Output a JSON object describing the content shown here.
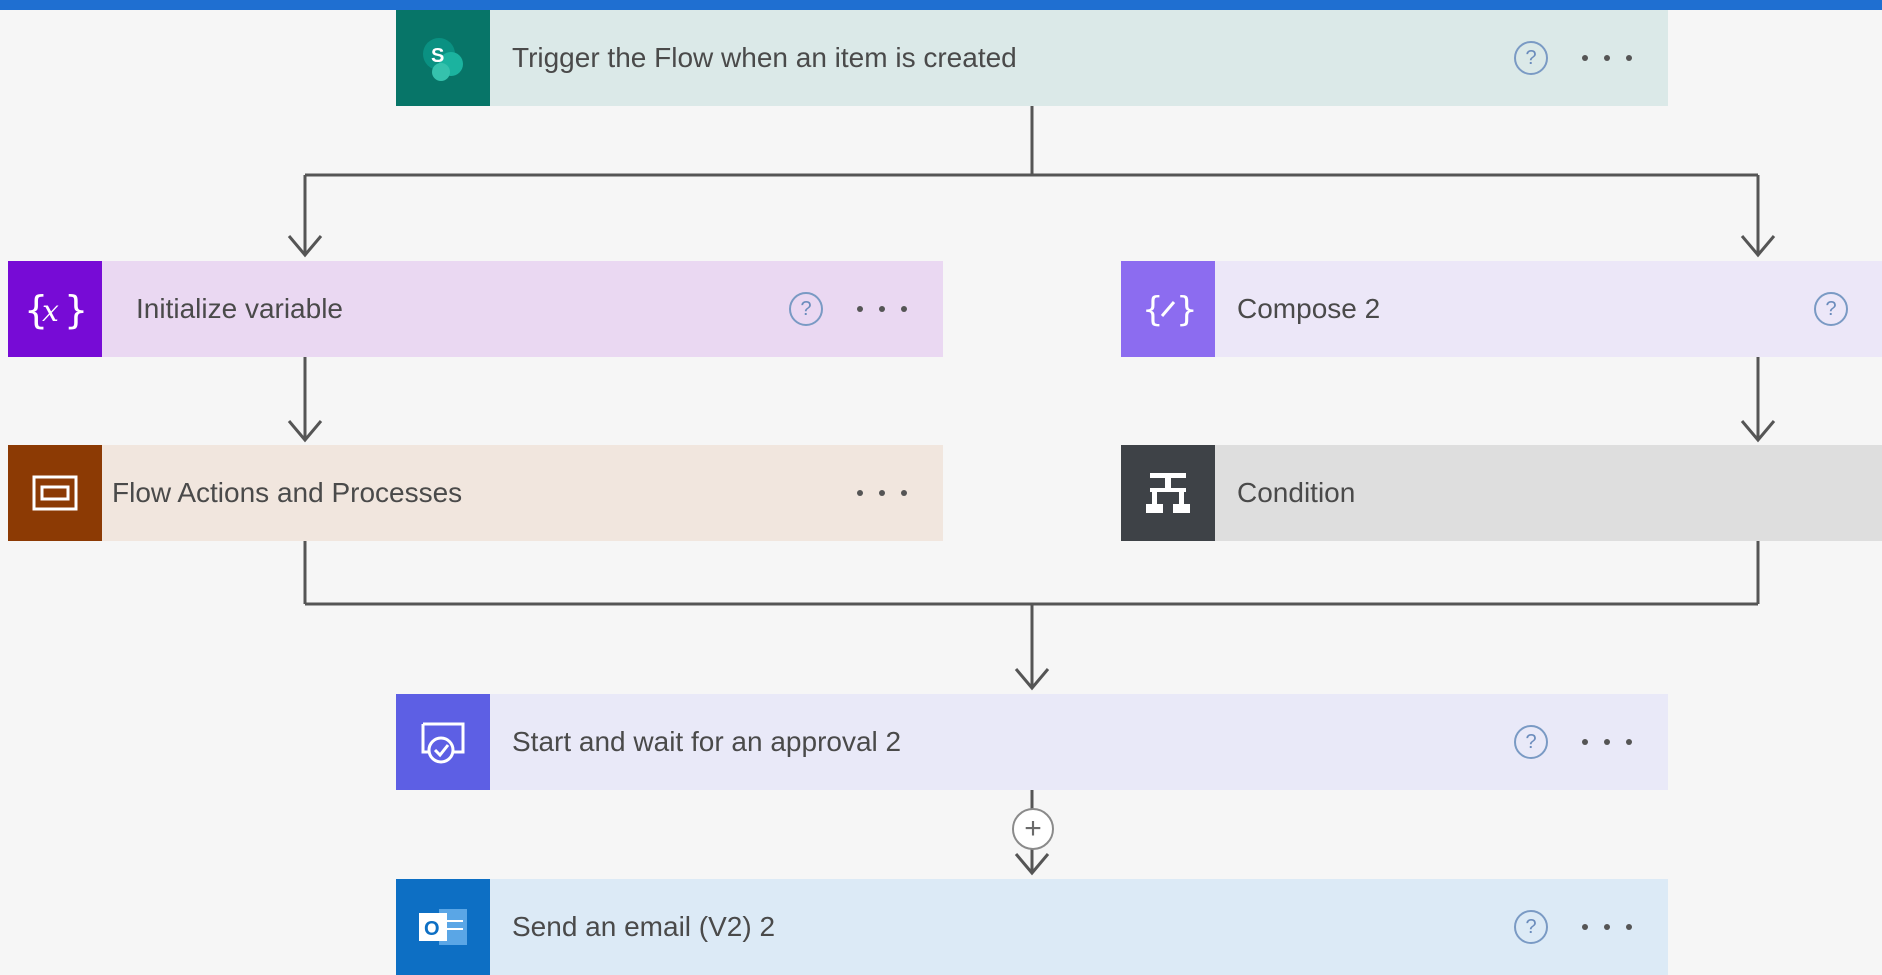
{
  "flow": {
    "trigger": {
      "title": "Trigger the Flow when an item is created",
      "icon": "sharepoint-icon"
    },
    "branch_left": [
      {
        "title": "Initialize variable",
        "icon": "variable-icon"
      },
      {
        "title": "Flow Actions and Processes",
        "icon": "scope-icon"
      }
    ],
    "branch_right": [
      {
        "title": "Compose 2",
        "icon": "compose-icon"
      },
      {
        "title": "Condition",
        "icon": "condition-icon"
      }
    ],
    "approval": {
      "title": "Start and wait for an approval 2",
      "icon": "approval-icon"
    },
    "email": {
      "title": "Send an email (V2) 2",
      "icon": "outlook-icon"
    }
  },
  "labels": {
    "help": "?",
    "add": "+"
  },
  "colors": {
    "accent_bar": "#1f6fd1",
    "sharepoint": "#077568",
    "variable": "#770bd6",
    "scope": "#8c3a04",
    "compose": "#8c6cf0",
    "condition": "#3e4247",
    "approval": "#5d5fe4",
    "outlook": "#0d6fc4"
  }
}
